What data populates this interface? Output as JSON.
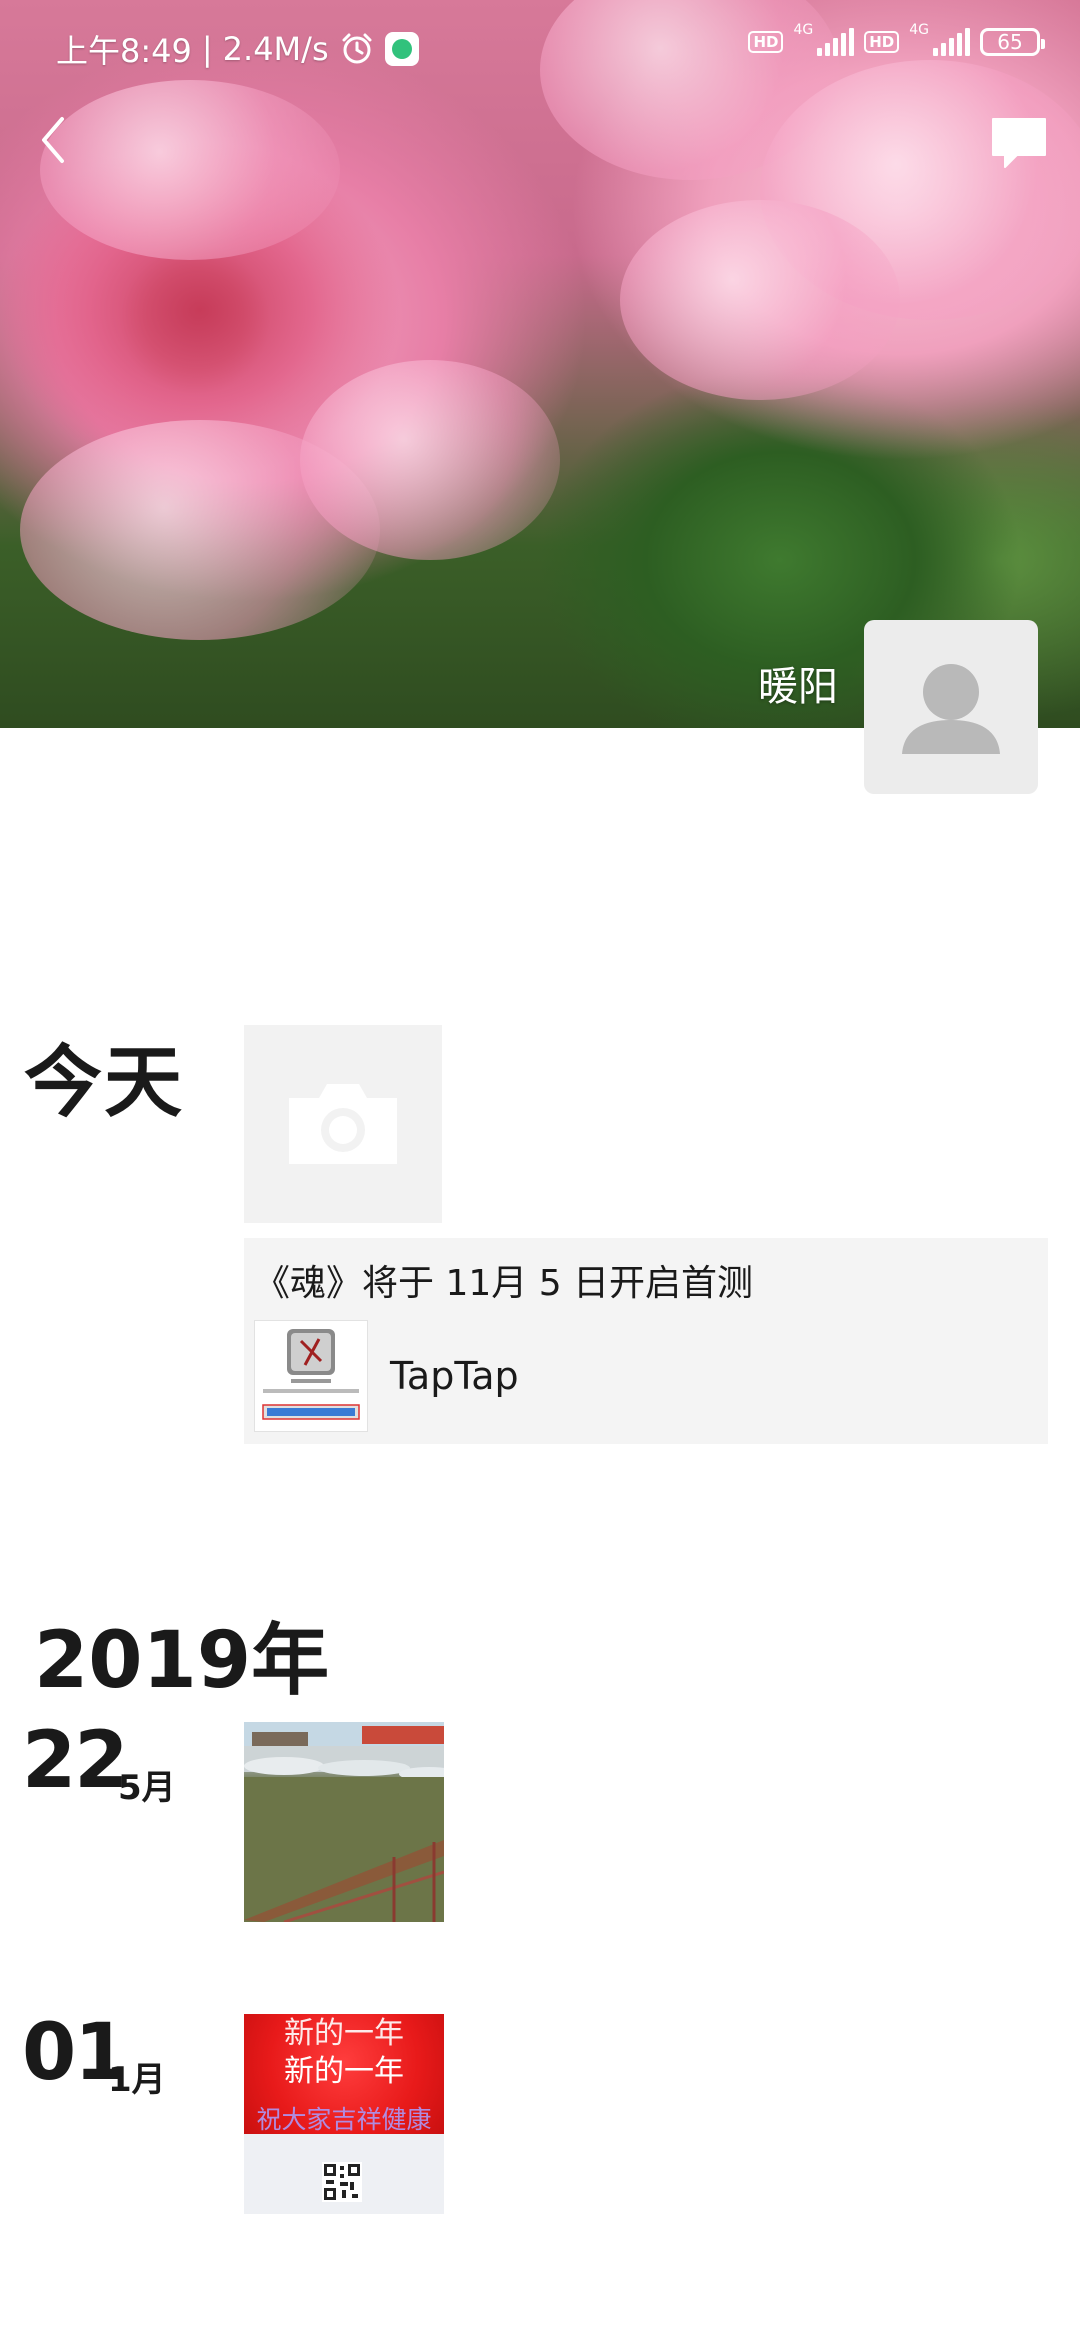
{
  "status_bar": {
    "time": "上午8:49",
    "net_speed": "2.4M/s",
    "hd1": "HD",
    "net1": "4G",
    "hd2": "HD",
    "net2": "4G",
    "battery": "65"
  },
  "profile": {
    "username": "暖阳"
  },
  "feed": {
    "today_label": "今天",
    "share": {
      "title": "《魂》将于 11月 5 日开启首测",
      "source": "TapTap"
    },
    "year_label": "2019年",
    "posts": [
      {
        "day": "22",
        "month": "5月"
      },
      {
        "day": "01",
        "month": "1月"
      }
    ],
    "newyear_text": {
      "line1": "新的一年",
      "line2": "新的一年",
      "line3": "祝大家吉祥健康"
    }
  },
  "icons": {
    "back": "chevron-left-icon",
    "comment": "message-bubble-icon",
    "camera": "camera-icon",
    "avatar": "person-icon"
  }
}
